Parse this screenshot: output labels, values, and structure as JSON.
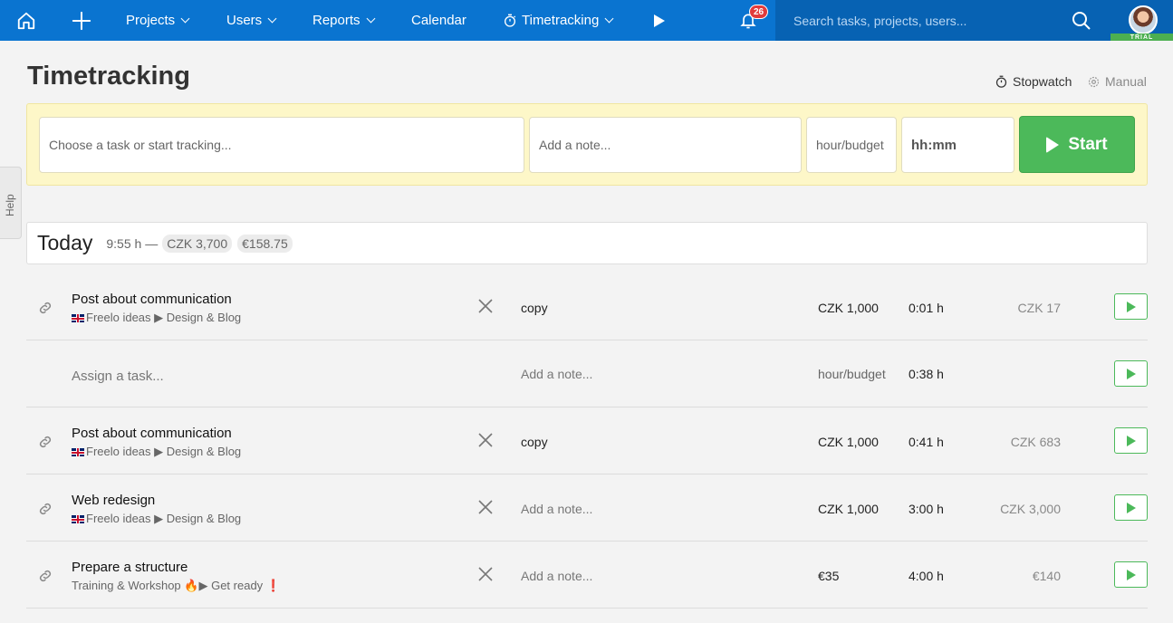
{
  "nav": {
    "projects": "Projects",
    "users": "Users",
    "reports": "Reports",
    "calendar": "Calendar",
    "timetracking": "Timetracking",
    "notifications_count": "26",
    "search_placeholder": "Search tasks, projects, users...",
    "trial": "TRIAL"
  },
  "help": "Help",
  "page": {
    "title": "Timetracking",
    "stopwatch": "Stopwatch",
    "manual": "Manual"
  },
  "tracker": {
    "task_placeholder": "Choose a task or start tracking...",
    "note_placeholder": "Add a note...",
    "rate_placeholder": "hour/budget",
    "time_placeholder": "hh:mm",
    "start": "Start"
  },
  "today": {
    "label": "Today",
    "total": "9:55 h —",
    "czk": "CZK 3,700",
    "eur": "€158.75"
  },
  "entries": [
    {
      "title": "Post about communication",
      "crumb_project": "Freelo ideas",
      "crumb_list": "Design & Blog",
      "note": "copy",
      "rate": "CZK 1,000",
      "duration": "0:01 h",
      "cost": "CZK 17"
    },
    {
      "assign": "Assign a task...",
      "note_placeholder": "Add a note...",
      "rate_placeholder": "hour/budget",
      "duration": "0:38 h"
    },
    {
      "title": "Post about communication",
      "crumb_project": "Freelo ideas",
      "crumb_list": "Design & Blog",
      "note": "copy",
      "rate": "CZK 1,000",
      "duration": "0:41 h",
      "cost": "CZK 683"
    },
    {
      "title": "Web redesign",
      "crumb_project": "Freelo ideas",
      "crumb_list": "Design & Blog",
      "note_placeholder": "Add a note...",
      "rate": "CZK 1,000",
      "duration": "3:00 h",
      "cost": "CZK 3,000"
    },
    {
      "title": "Prepare a structure",
      "crumb_project": "Training & Workshop",
      "crumb_list": "Get ready",
      "note_placeholder": "Add a note...",
      "rate": "€35",
      "duration": "4:00 h",
      "cost": "€140"
    }
  ],
  "colors": {
    "nav": "#0a74d0",
    "accent_green": "#4cb95a",
    "tracker_bg": "#fdf7c8"
  }
}
